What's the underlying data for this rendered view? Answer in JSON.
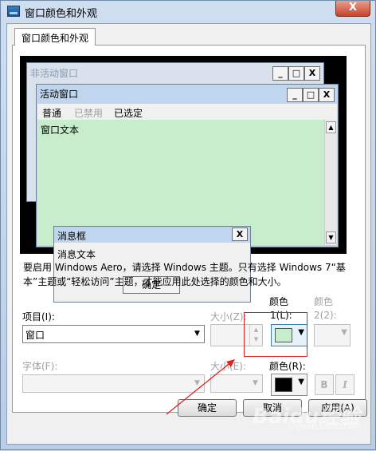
{
  "window": {
    "title": "窗口颜色和外观",
    "close_label": "X"
  },
  "tab": {
    "label": "窗口颜色和外观"
  },
  "preview": {
    "inactive_title": "非活动窗口",
    "active_title": "活动窗口",
    "menu": [
      "普通",
      "已禁用",
      "已选定"
    ],
    "window_text": "窗口文本",
    "msgbox_title": "消息框",
    "msgbox_text": "消息文本",
    "msgbox_ok": "确定",
    "window_buttons": [
      "_",
      "□",
      "X"
    ]
  },
  "info_text": "要启用 Windows Aero，请选择 Windows 主题。只有选择 Windows 7“基本”主题或“轻松访问”主题，才能应用此处选择的颜色和大小。",
  "item": {
    "label": "项目(I):",
    "value": "窗口"
  },
  "size": {
    "label": "大小(Z):"
  },
  "color1": {
    "label_top": "颜色",
    "label": "1(L):",
    "swatch": "#c7edcc"
  },
  "color2": {
    "label_top": "颜色",
    "label": "2(2):"
  },
  "font": {
    "label": "字体(F):"
  },
  "font_size": {
    "label": "大小(E):"
  },
  "font_color": {
    "label": "颜色(R):",
    "swatch": "#000000"
  },
  "style": {
    "bold": "B",
    "italic": "I"
  },
  "buttons": {
    "ok": "确定",
    "cancel": "取消",
    "apply": "应用(A)"
  },
  "watermark": "Baidu经验",
  "watermark_sub": "jingyan.baidu.com"
}
